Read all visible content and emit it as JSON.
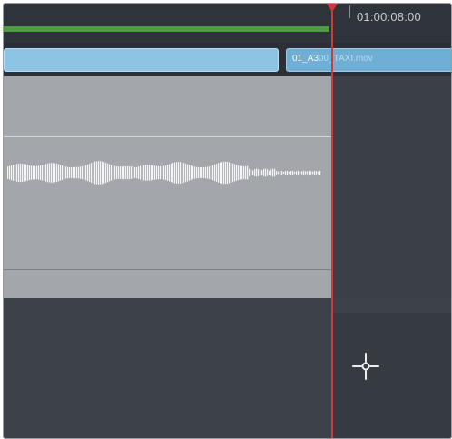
{
  "ruler": {
    "timecode": "01:00:08:00"
  },
  "video_track": {
    "clip_right_label_visible": "01_A3",
    "clip_right_label_obscured": "00_TAXI.mov"
  },
  "colors": {
    "background": "#343941",
    "video_clip": "#8dc3e3",
    "audio_clip": "#a3a6aa",
    "playhead": "#d23a3a",
    "render_bar": "#4f9a43"
  },
  "icons": {
    "playhead": "playhead-marker-icon",
    "cursor": "move-cursor-icon"
  }
}
